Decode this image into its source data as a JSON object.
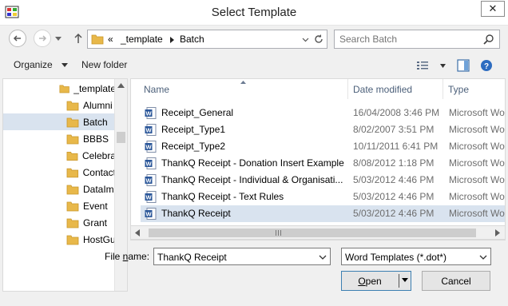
{
  "window": {
    "title": "Select Template",
    "close_glyph": "✕"
  },
  "address_bar": {
    "overflow_glyph": "«",
    "crumbs": [
      "_template",
      "Batch"
    ],
    "search_placeholder": "Search Batch"
  },
  "toolbar": {
    "organize_label": "Organize",
    "new_folder_label": "New folder"
  },
  "tree": {
    "items": [
      {
        "label": "_template"
      },
      {
        "label": "Alumni"
      },
      {
        "label": "Batch"
      },
      {
        "label": "BBBS"
      },
      {
        "label": "Celebra"
      },
      {
        "label": "Contact"
      },
      {
        "label": "DataIm"
      },
      {
        "label": "Event"
      },
      {
        "label": "Grant"
      },
      {
        "label": "HostGu"
      }
    ],
    "selected": "Batch"
  },
  "file_list": {
    "columns": {
      "name": "Name",
      "date": "Date modified",
      "type": "Type"
    },
    "files": [
      {
        "name": "Receipt_General",
        "date": "16/04/2008 3:46 PM",
        "type": "Microsoft Wo"
      },
      {
        "name": "Receipt_Type1",
        "date": "8/02/2007 3:51 PM",
        "type": "Microsoft Wo"
      },
      {
        "name": "Receipt_Type2",
        "date": "10/11/2011 6:41 PM",
        "type": "Microsoft Wo"
      },
      {
        "name": "ThankQ Receipt - Donation Insert Example",
        "date": "8/08/2012 1:18 PM",
        "type": "Microsoft Wo"
      },
      {
        "name": "ThankQ Receipt - Individual & Organisati...",
        "date": "5/03/2012 4:46 PM",
        "type": "Microsoft Wo"
      },
      {
        "name": "ThankQ Receipt - Text Rules",
        "date": "5/03/2012 4:46 PM",
        "type": "Microsoft Wo"
      },
      {
        "name": "ThankQ Receipt",
        "date": "5/03/2012 4:46 PM",
        "type": "Microsoft Wo"
      }
    ],
    "selected": "ThankQ Receipt"
  },
  "bottom": {
    "file_name_label_pre": "File ",
    "file_name_label_ul": "n",
    "file_name_label_post": "ame:",
    "file_name_value": "ThankQ Receipt",
    "file_type_value": "Word Templates (*.dot*)",
    "open_label_ul": "O",
    "open_label_post": "pen",
    "cancel_label": "Cancel"
  },
  "colors": {
    "selection": "#d9e3ef",
    "header_text": "#4c607a",
    "folder": "#e8b84a",
    "word_blue": "#2b579a"
  }
}
